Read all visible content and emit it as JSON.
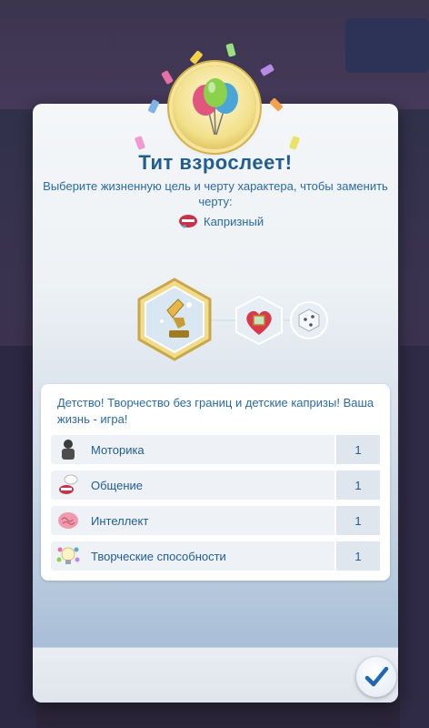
{
  "dialog": {
    "title": "Тит взрослеет!",
    "subtitle": "Выберите жизненную цель и черту характера, чтобы заменить черту:",
    "trait_name": "Капризный"
  },
  "panel": {
    "description": "Детство! Творчество без границ и детские капризы! Ваша жизнь - игра!",
    "skills": [
      {
        "label": "Моторика",
        "value": "1",
        "icon": "motor-skill-icon"
      },
      {
        "label": "Общение",
        "value": "1",
        "icon": "social-skill-icon"
      },
      {
        "label": "Интеллект",
        "value": "1",
        "icon": "brain-icon"
      },
      {
        "label": "Творческие способности",
        "value": "1",
        "icon": "creativity-icon"
      }
    ]
  },
  "colors": {
    "title": "#1f5d93",
    "text": "#2a6aa8",
    "gold": "#d3b24a"
  }
}
